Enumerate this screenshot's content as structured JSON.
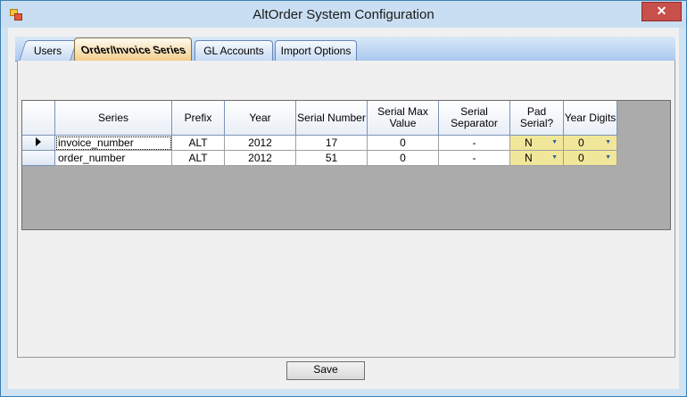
{
  "window": {
    "title": "AltOrder System Configuration",
    "close_label": "✕"
  },
  "tabs": [
    {
      "label": "Users"
    },
    {
      "label": "Order/Invoice Series"
    },
    {
      "label": "GL Accounts"
    },
    {
      "label": "Import Options"
    }
  ],
  "grid": {
    "headers": [
      "Series",
      "Prefix",
      "Year",
      "Serial Number",
      "Serial Max Value",
      "Serial Separator",
      "Pad Serial?",
      "Year Digits"
    ],
    "rows": [
      {
        "series": "invoice_number",
        "prefix": "ALT",
        "year": "2012",
        "serial_number": "17",
        "serial_max": "0",
        "separator": "-",
        "pad_serial": "N",
        "year_digits": "0"
      },
      {
        "series": "order_number",
        "prefix": "ALT",
        "year": "2012",
        "serial_number": "51",
        "serial_max": "0",
        "separator": "-",
        "pad_serial": "N",
        "year_digits": "0"
      }
    ]
  },
  "buttons": {
    "save_label": "Save"
  },
  "colors": {
    "combo_cell": "#f1e79a",
    "active_tab": "#f3cc87",
    "close_button": "#c7504b"
  }
}
